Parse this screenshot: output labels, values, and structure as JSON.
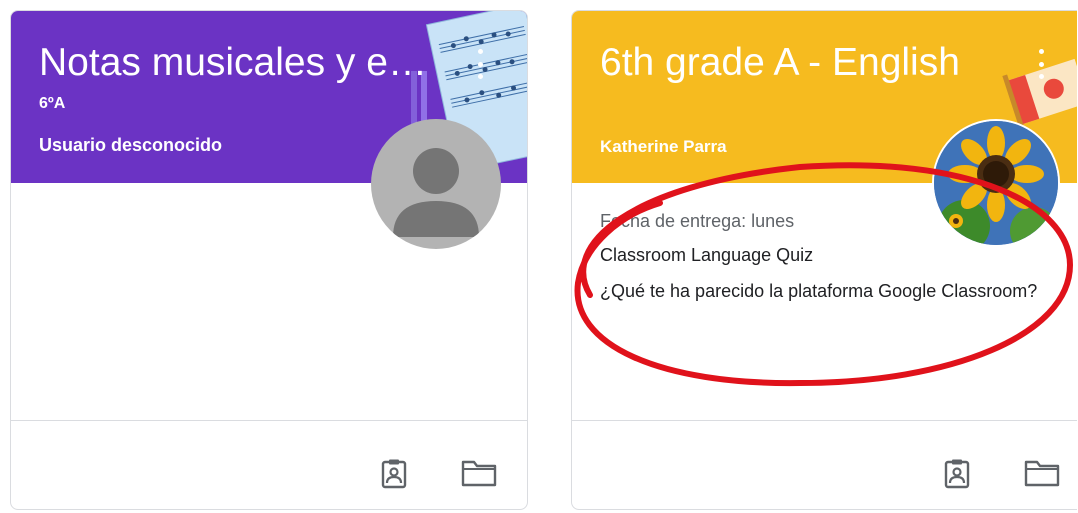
{
  "cards": [
    {
      "title": "Notas musicales y ejercicios",
      "section": "6ºA",
      "teacher": "Usuario desconocido",
      "header_color": "#6b33c4",
      "header_art": "sheet-music-illustration",
      "avatar": "default-user-avatar"
    },
    {
      "title": "6th grade A - English",
      "section": "",
      "teacher": "Katherine Parra",
      "header_color": "#f6bb1f",
      "header_art": "flag-illustration",
      "avatar": "sunflower-photo-avatar",
      "due": "Fecha de entrega: lunes",
      "assignments": [
        "Classroom Language Quiz",
        "¿Qué te ha parecido la plataforma Google Classroom?"
      ]
    }
  ],
  "annotation_color": "#e0121b",
  "footer_icons": [
    "portfolio-icon",
    "folder-icon"
  ]
}
